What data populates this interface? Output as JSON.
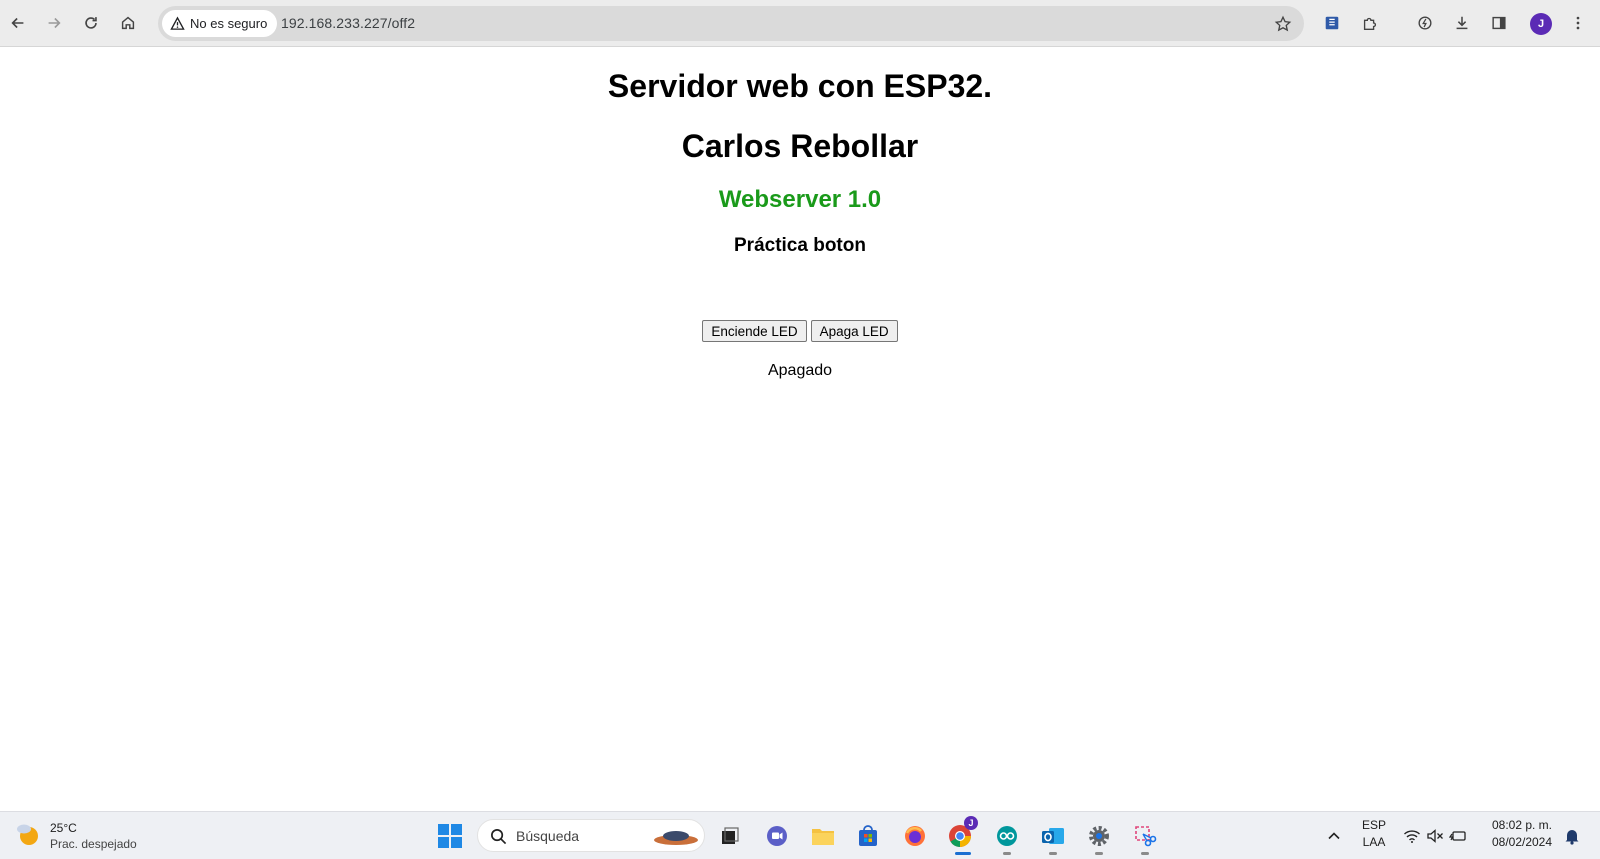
{
  "browser": {
    "security_label": "No es seguro",
    "url": "192.168.233.227/off2",
    "profile_initial": "J"
  },
  "page": {
    "title": "Servidor web con ESP32.",
    "author": "Carlos Rebollar",
    "subtitle": "Webserver 1.0",
    "section": "Práctica boton",
    "buttons": {
      "on": "Enciende LED",
      "off": "Apaga LED"
    },
    "status": "Apagado",
    "accent_color": "#1a9a1a"
  },
  "taskbar": {
    "weather": {
      "temp": "25°C",
      "desc": "Prac. despejado"
    },
    "search_label": "Búsqueda",
    "language": {
      "line1": "ESP",
      "line2": "LAA"
    },
    "clock": {
      "time": "08:02 p. m.",
      "date": "08/02/2024"
    },
    "chrome_badge": "J"
  }
}
